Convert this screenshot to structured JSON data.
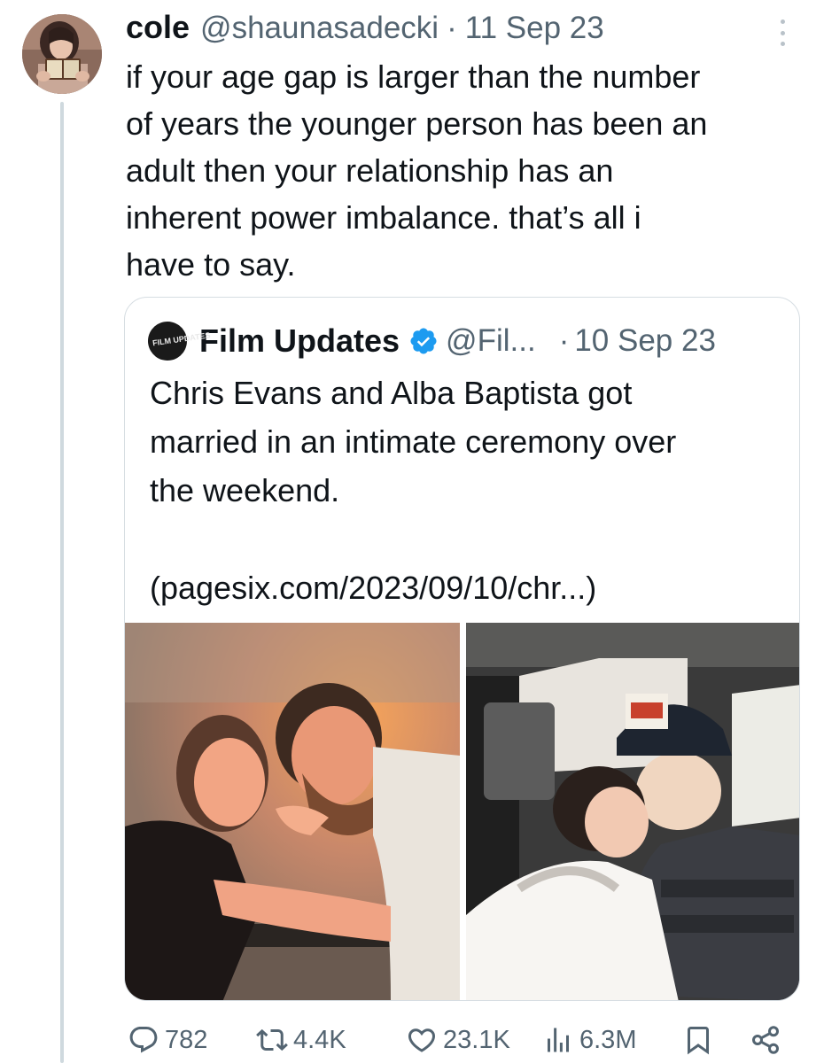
{
  "tweet": {
    "display_name": "cole",
    "handle": "@shaunasadecki",
    "separator": "·",
    "date": "11 Sep 23",
    "text": "if your age gap is larger than the number\nof years the younger person has been an\nadult then your relationship has an\ninherent power imbalance. that’s all i\nhave to say.",
    "avatar_icon": "profile-photo-reading-book",
    "more_icon": "more-vertical-icon"
  },
  "quote": {
    "avatar_logo_text": "FILM UPDATES",
    "display_name": "Film Updates",
    "verified_icon": "verified-badge-icon",
    "verified_color": "#1d9bf0",
    "handle": "@Fil...",
    "separator": "·",
    "date": "10 Sep 23",
    "text": "Chris Evans and Alba Baptista got\nmarried in an intimate ceremony over\nthe weekend.\n\n(pagesix.com/2023/09/10/chr...)",
    "media": [
      {
        "icon": "couple-selfie-photo"
      },
      {
        "icon": "couple-kissing-in-car-photo"
      }
    ]
  },
  "actions": {
    "reply": {
      "icon": "reply-icon",
      "count": "782"
    },
    "repost": {
      "icon": "repost-icon",
      "count": "4.4K"
    },
    "like": {
      "icon": "heart-icon",
      "count": "23.1K"
    },
    "views": {
      "icon": "views-chart-icon",
      "count": "6.3M"
    },
    "bookmark": {
      "icon": "bookmark-icon"
    },
    "share": {
      "icon": "share-icon"
    }
  },
  "colors": {
    "text_primary": "#0f1419",
    "text_secondary": "#536471",
    "border": "#cfd9de"
  }
}
